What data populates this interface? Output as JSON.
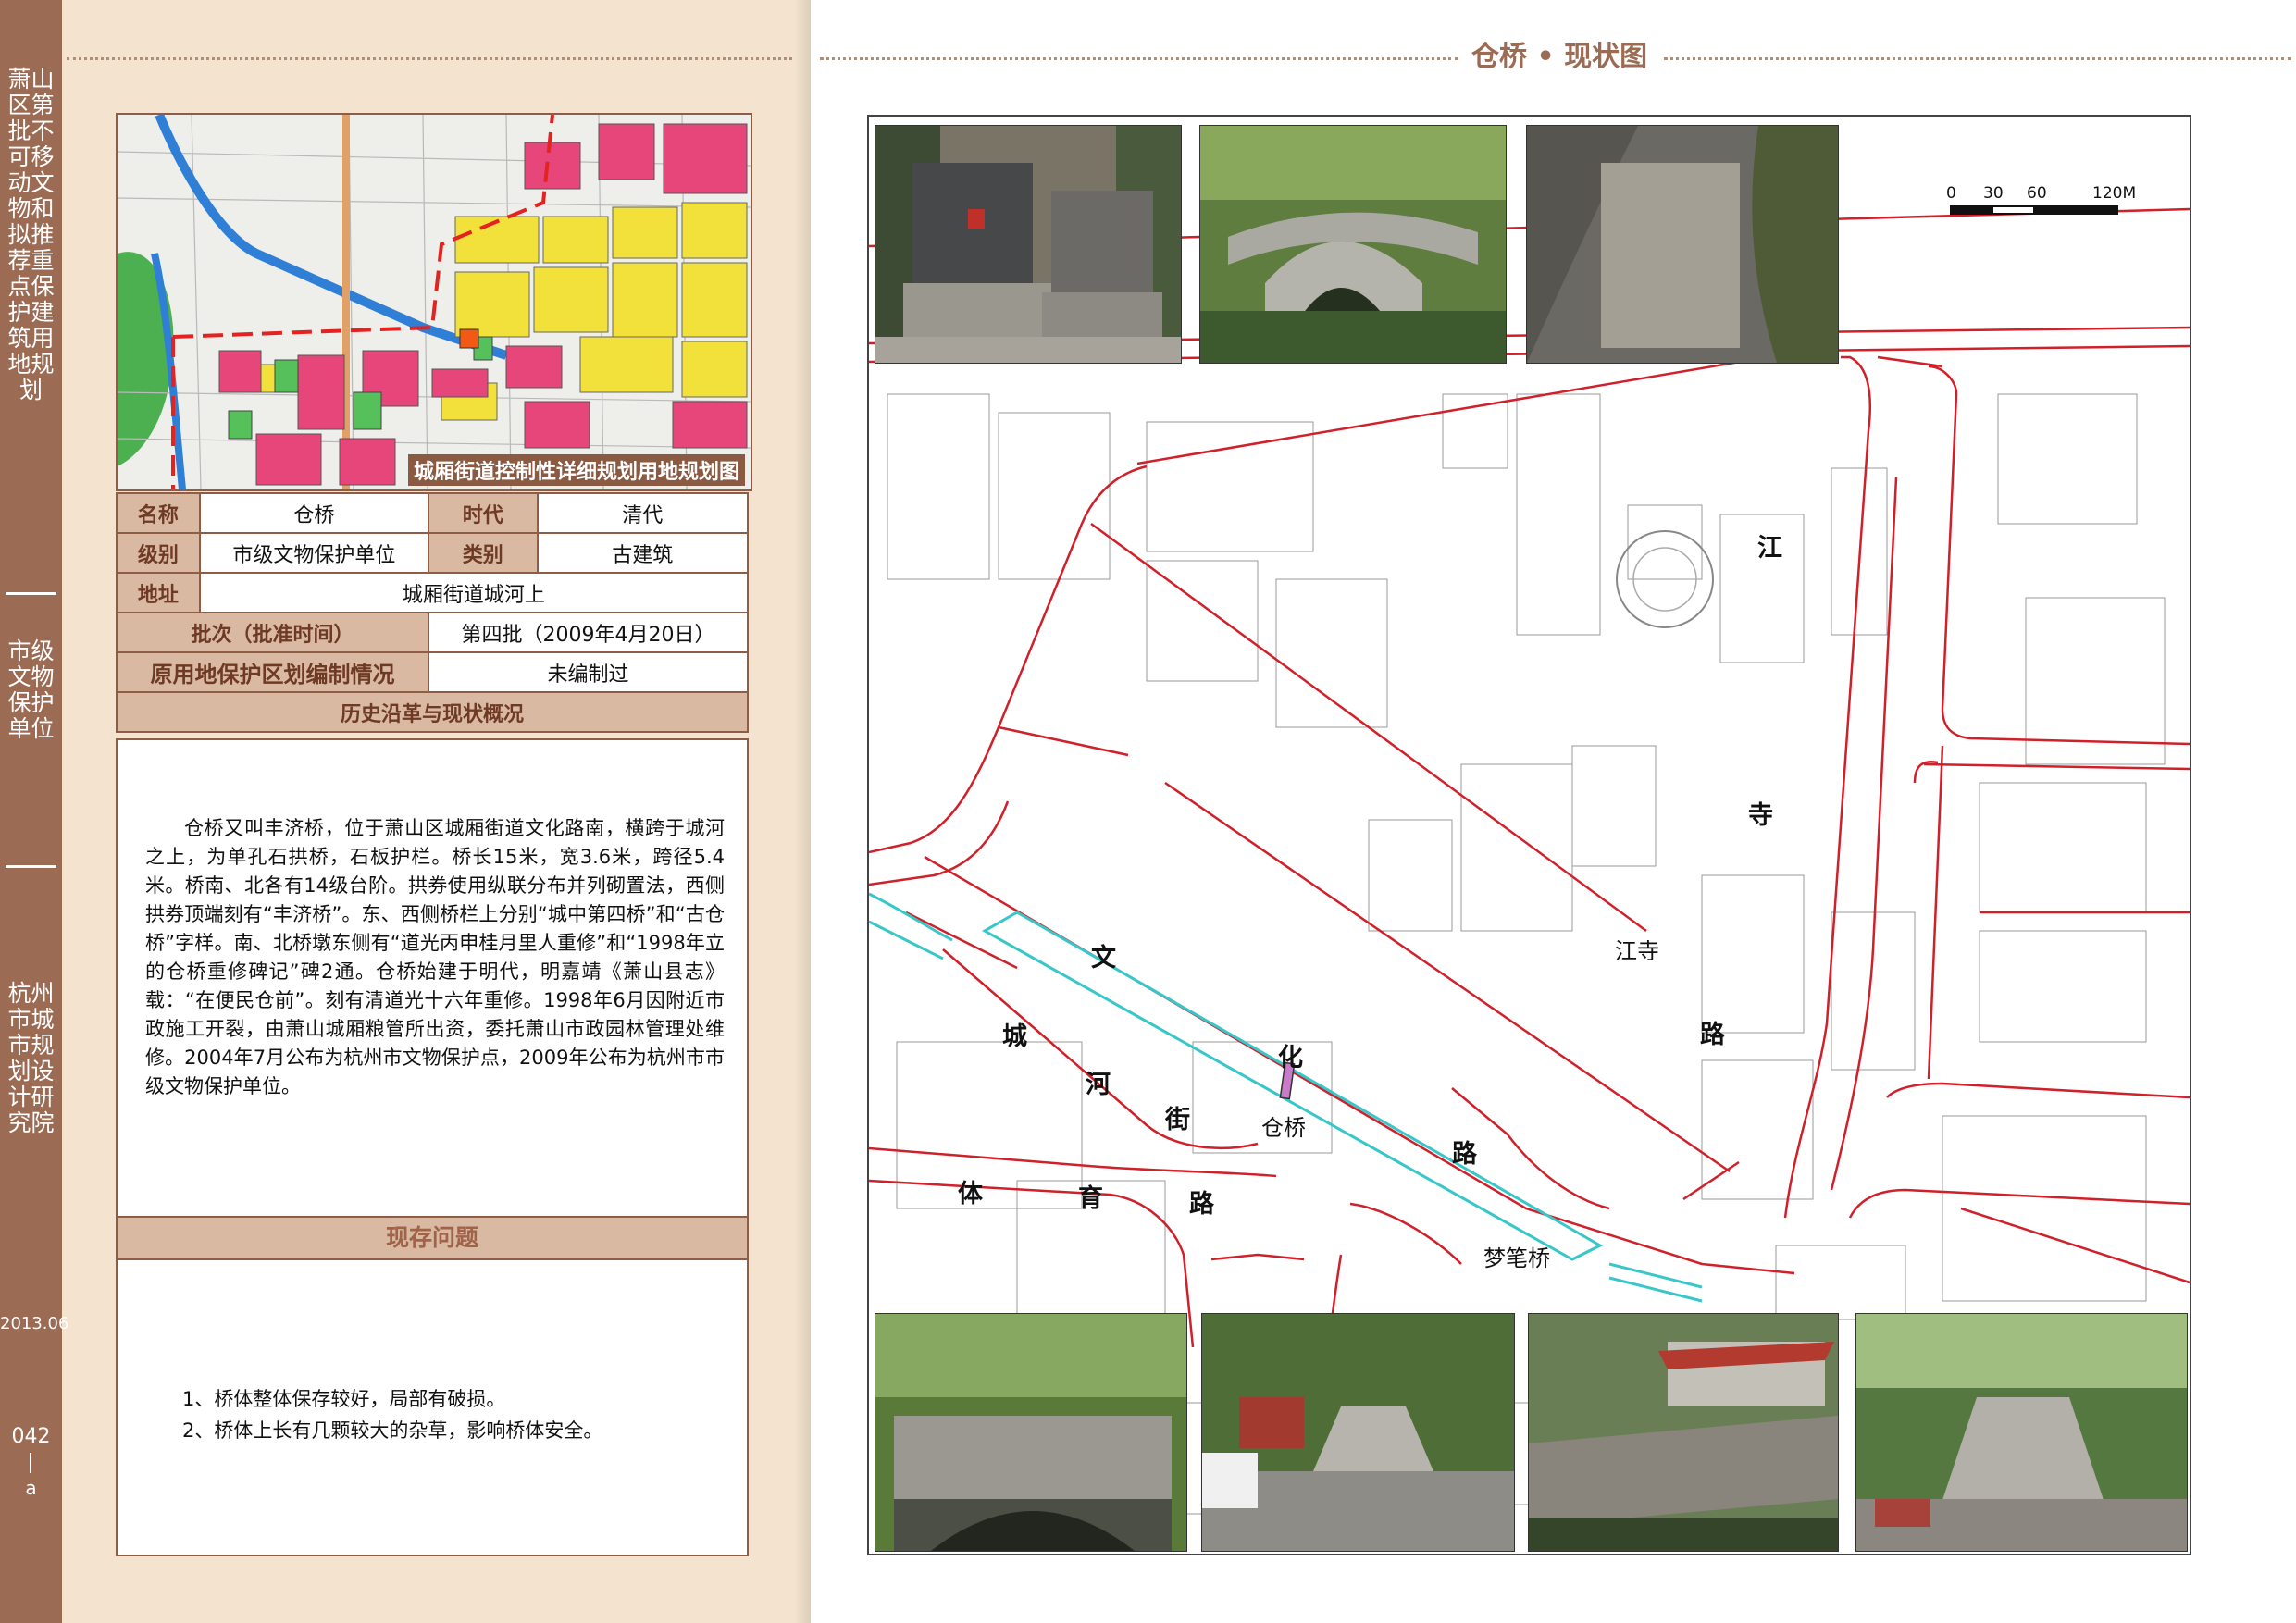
{
  "sidebar": {
    "series_title": "萧山区第批不可移动文物和拟推荐重点保护建筑用地规划",
    "category": "市级文物保护单位",
    "institute": "杭州市城市规划设计研究院",
    "date": "2013.06",
    "page_number": "042",
    "page_suffix": "a"
  },
  "plan": {
    "caption": "城厢街道控制性详细规划用地规划图"
  },
  "info": {
    "name_label": "名称",
    "name_value": "仓桥",
    "era_label": "时代",
    "era_value": "清代",
    "level_label": "级别",
    "level_value": "市级文物保护单位",
    "type_label": "类别",
    "type_value": "古建筑",
    "address_label": "地址",
    "address_value": "城厢街道城河上",
    "batch_label": "批次（批准时间）",
    "batch_value": "第四批（2009年4月20日）",
    "landuse_label": "原用地保护区划编制情况",
    "landuse_value": "未编制过",
    "history_header": "历史沿革与现状概况"
  },
  "history_text": "仓桥又叫丰济桥，位于萧山区城厢街道文化路南，横跨于城河之上，为单孔石拱桥，石板护栏。桥长15米，宽3.6米，跨径5.4米。桥南、北各有14级台阶。拱券使用纵联分布并列砌置法，西侧拱券顶端刻有“丰济桥”。东、西侧桥栏上分别“城中第四桥”和“古仓桥”字样。南、北桥墩东侧有“道光丙申桂月里人重修”和“1998年立的仓桥重修碑记”碑2通。仓桥始建于明代，明嘉靖《萧山县志》载：“在便民仓前”。刻有清道光十六年重修。1998年6月因附近市政施工开裂，由萧山城厢粮管所出资，委托萧山市政园林管理处维修。2004年7月公布为杭州市文物保护点，2009年公布为杭州市市级文物保护单位。",
  "problems": {
    "header": "现存问题",
    "items": [
      "1、桥体整体保存较好，局部有破损。",
      "2、桥体上长有几颗较大的杂草，影响桥体安全。"
    ]
  },
  "right": {
    "title": "仓桥 • 现状图",
    "scale_ticks": [
      "0",
      "30",
      "60",
      "120M"
    ],
    "labels": {
      "jiangsi_road": [
        "江",
        "寺",
        "路"
      ],
      "wenhua_road": [
        "文",
        "化",
        "路"
      ],
      "chenghe_street": [
        "城",
        "河",
        "街"
      ],
      "tiyu_road": [
        "体",
        "育",
        "路"
      ],
      "cangqiao": "仓桥",
      "jiangsi": "江寺",
      "mengbi_bridge": "梦笔桥"
    }
  },
  "colors": {
    "band": "#9c6b54",
    "paper": "#f4e4cf",
    "label_bg": "#d9b9a1",
    "road_red": "#d0202a",
    "river_cyan": "#38c7c9"
  }
}
